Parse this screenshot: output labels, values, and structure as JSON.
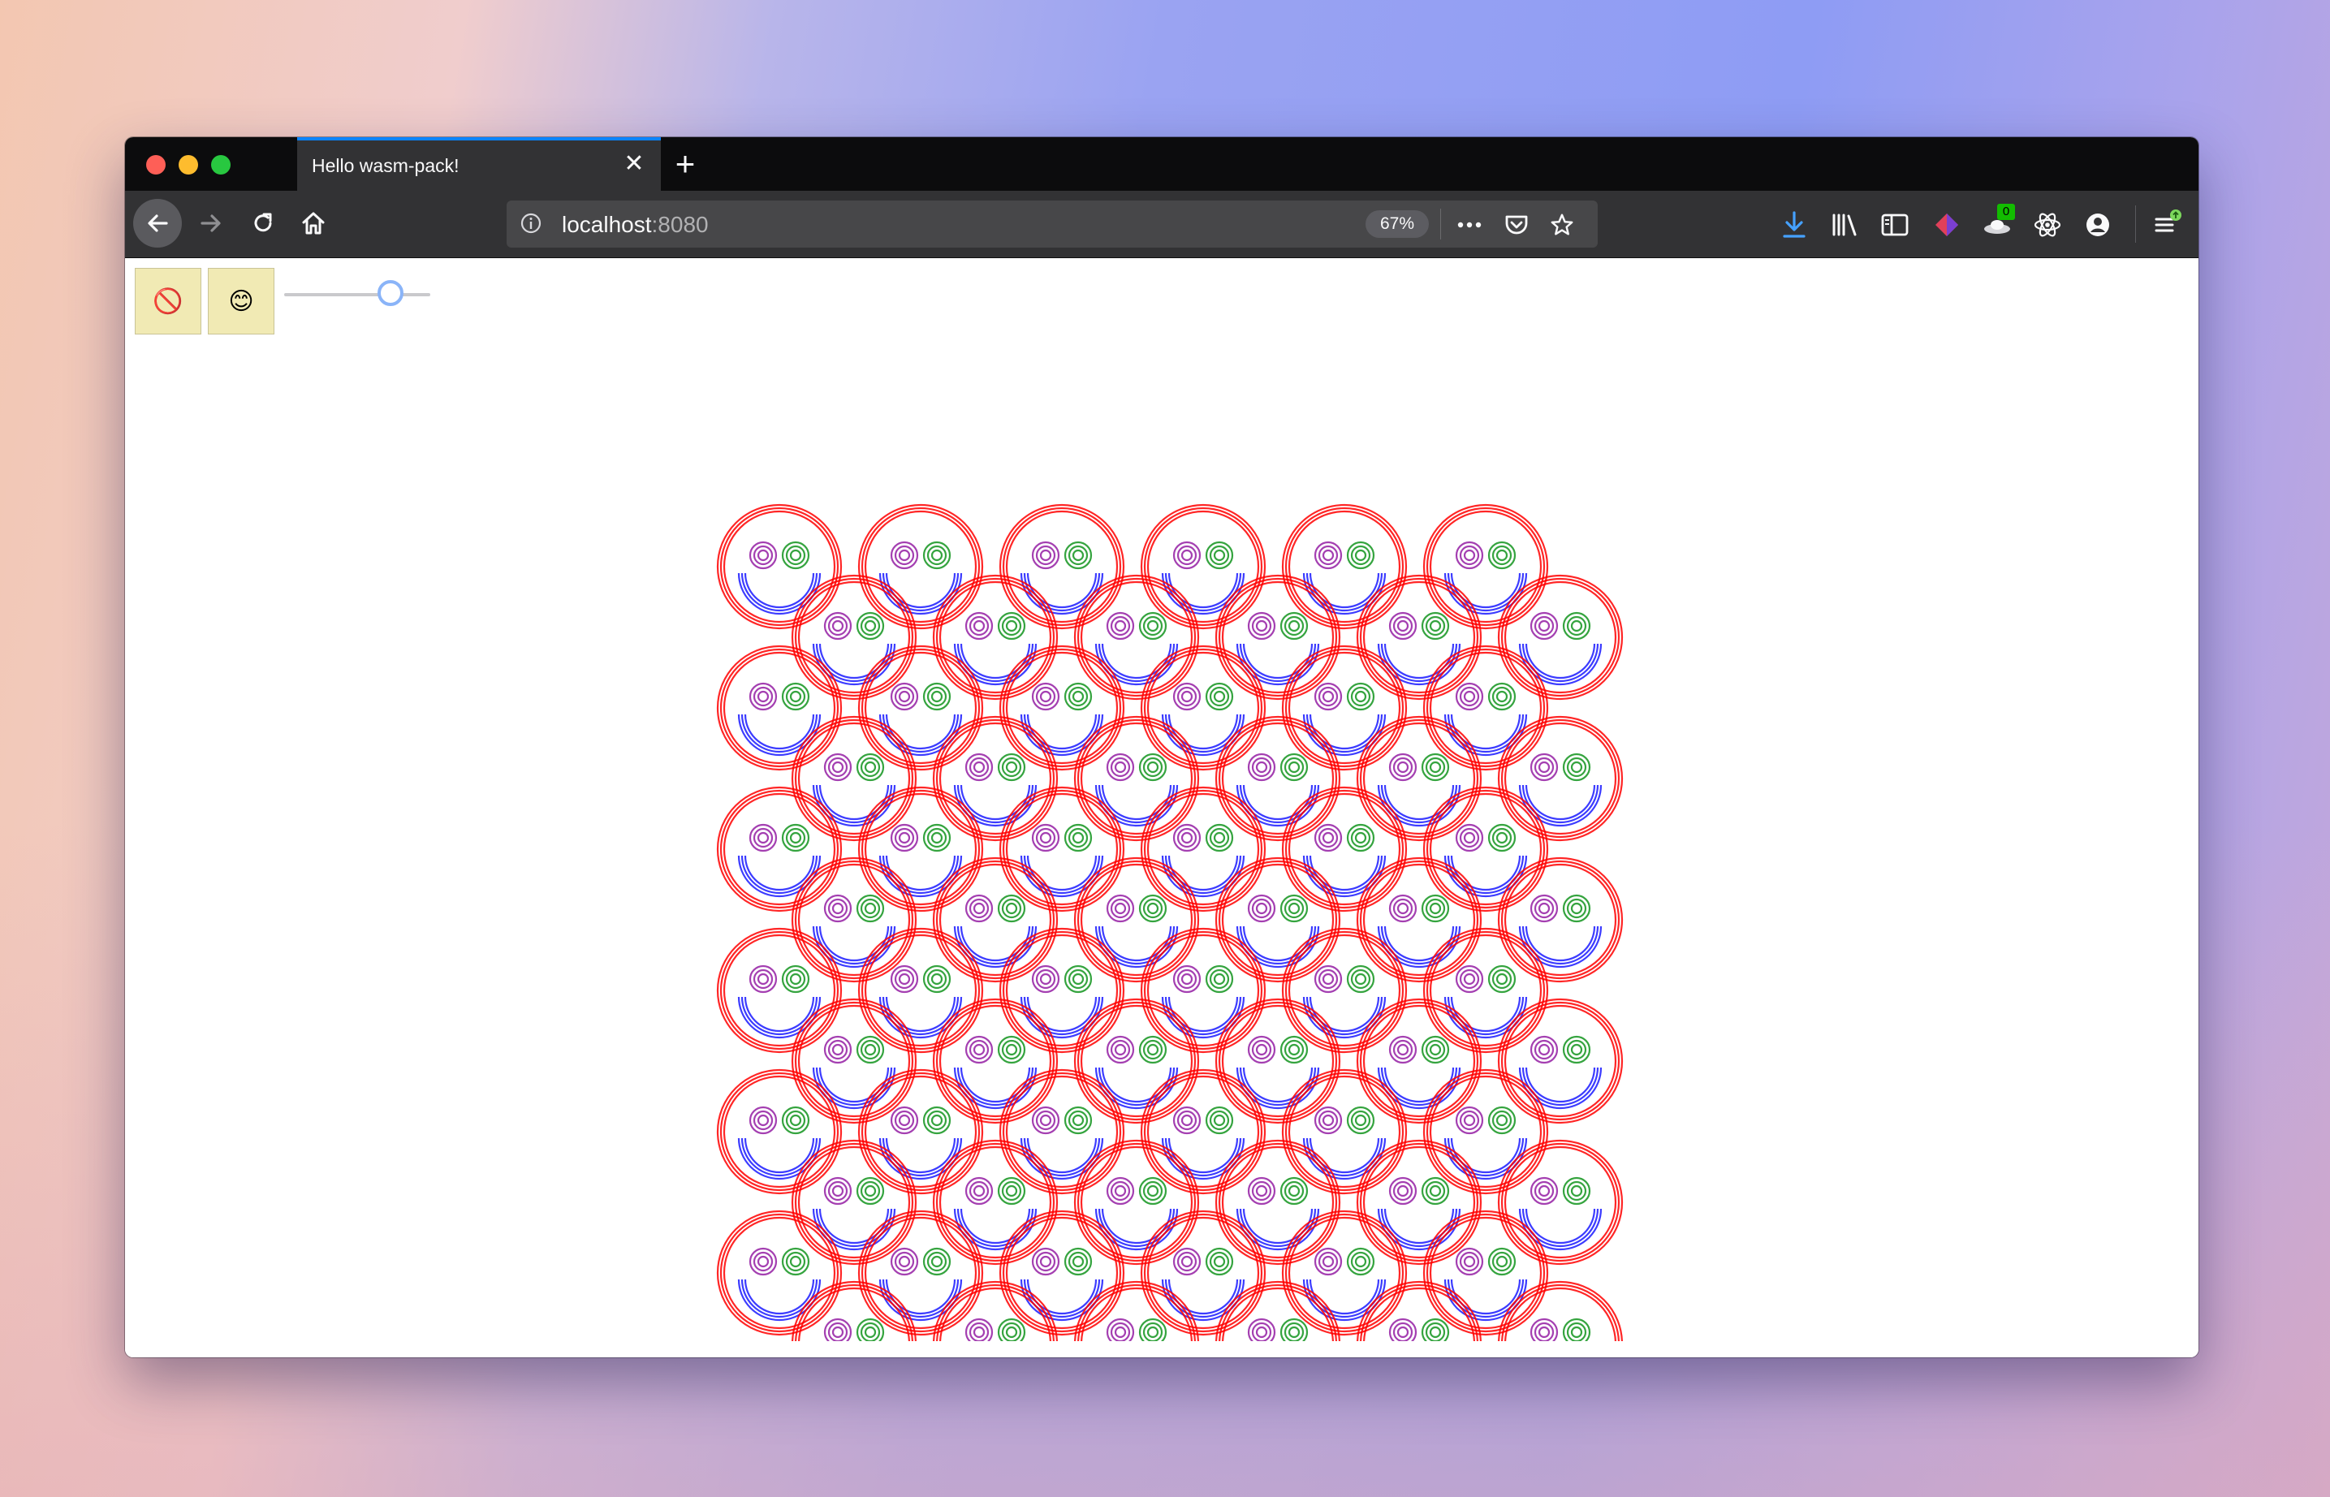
{
  "browser": {
    "tab": {
      "title": "Hello wasm-pack!",
      "close_icon": "close-icon"
    },
    "new_tab_label": "+",
    "url": {
      "host": "localhost",
      "port": ":8080"
    },
    "zoom": "67%",
    "download_badge_count": "0"
  },
  "controls": {
    "stop_button_icon": "🚫",
    "smile_button_icon": "😊",
    "slider_value_fraction": 0.73
  },
  "colors": {
    "face_ring": "#ff0000",
    "left_eye": "#9a2aa8",
    "right_eye": "#1f9a2a",
    "smile": "#1a1aff"
  },
  "canvas": {
    "description_rows": 12,
    "faces_per_row": 6
  }
}
